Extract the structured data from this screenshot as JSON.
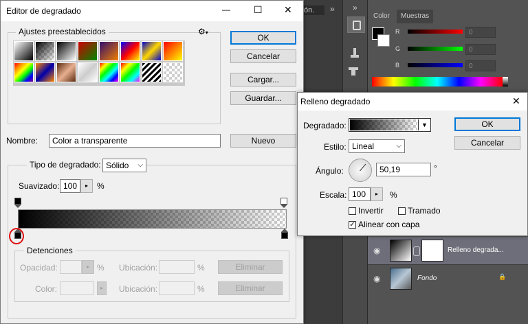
{
  "gradient_editor": {
    "title": "Editor de degradado",
    "minimize_glyph": "—",
    "maximize_glyph": "☐",
    "close_glyph": "✕",
    "presets_label": "Ajustes preestablecidos",
    "gear_glyph": "⚙",
    "ok": "OK",
    "cancel": "Cancelar",
    "load": "Cargar...",
    "save": "Guardar...",
    "name_label": "Nombre:",
    "name_value": "Color a transparente",
    "new_button": "Nuevo",
    "gradient_type_label": "Tipo de degradado:",
    "gradient_type_value": "Sólido",
    "smoothness_label": "Suavizado:",
    "smoothness_value": "100",
    "percent": "%",
    "stops_label": "Detenciones",
    "opacity_label": "Opacidad:",
    "location_label": "Ubicación:",
    "color_label": "Color:",
    "delete_button": "Eliminar"
  },
  "gradient_fill": {
    "title": "Relleno degradado",
    "gradient_label": "Degradado:",
    "style_label": "Estilo:",
    "style_value": "Lineal",
    "angle_label": "Ángulo:",
    "angle_value": "50,19",
    "degree_symbol": "°",
    "scale_label": "Escala:",
    "scale_value": "100",
    "percent": "%",
    "invert_label": "Invertir",
    "invert_checked": false,
    "dither_label": "Tramado",
    "dither_checked": false,
    "align_label": "Alinear con capa",
    "align_checked": true,
    "check_glyph": "✓",
    "ok": "OK",
    "cancel": "Cancelar",
    "close_glyph": "✕"
  },
  "photoshop": {
    "doc_tab_fragment": "ón.",
    "tab_color": "Color",
    "tab_swatches": "Muestras",
    "channel_r": "R",
    "channel_g": "G",
    "channel_b": "B",
    "value_r": "0",
    "value_g": "0",
    "value_b": "0",
    "layers": [
      {
        "name": "Relleno degrada...",
        "italic": false
      },
      {
        "name": "Fondo",
        "italic": true
      }
    ],
    "lock_glyph": "🔒",
    "eye_glyph": "◉",
    "chevrons": "»"
  }
}
